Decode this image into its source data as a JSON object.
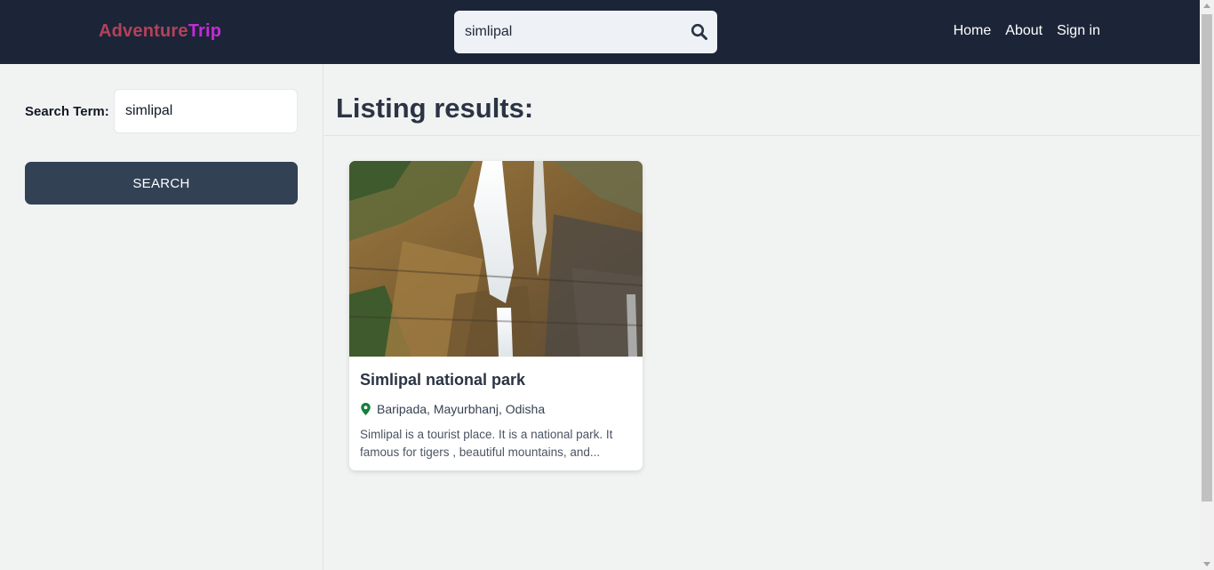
{
  "header": {
    "logo_part1": "Adventure",
    "logo_part2": "Trip",
    "search_value": "simlipal",
    "nav": [
      "Home",
      "About",
      "Sign in"
    ]
  },
  "sidebar": {
    "search_term_label": "Search Term:",
    "search_term_value": "simlipal",
    "search_button": "SEARCH"
  },
  "main": {
    "heading": "Listing results:",
    "listings": [
      {
        "title": "Simlipal national park",
        "location": "Baripada, Mayurbhanj, Odisha",
        "description": "Simlipal is a tourist place. It is a national park. It famous for tigers , beautiful mountains, and..."
      }
    ]
  },
  "colors": {
    "header_bg": "#1c2538",
    "logo_adventure": "#b5415a",
    "logo_trip": "#c42bd6",
    "button_bg": "#334155",
    "pin": "#15803d"
  }
}
